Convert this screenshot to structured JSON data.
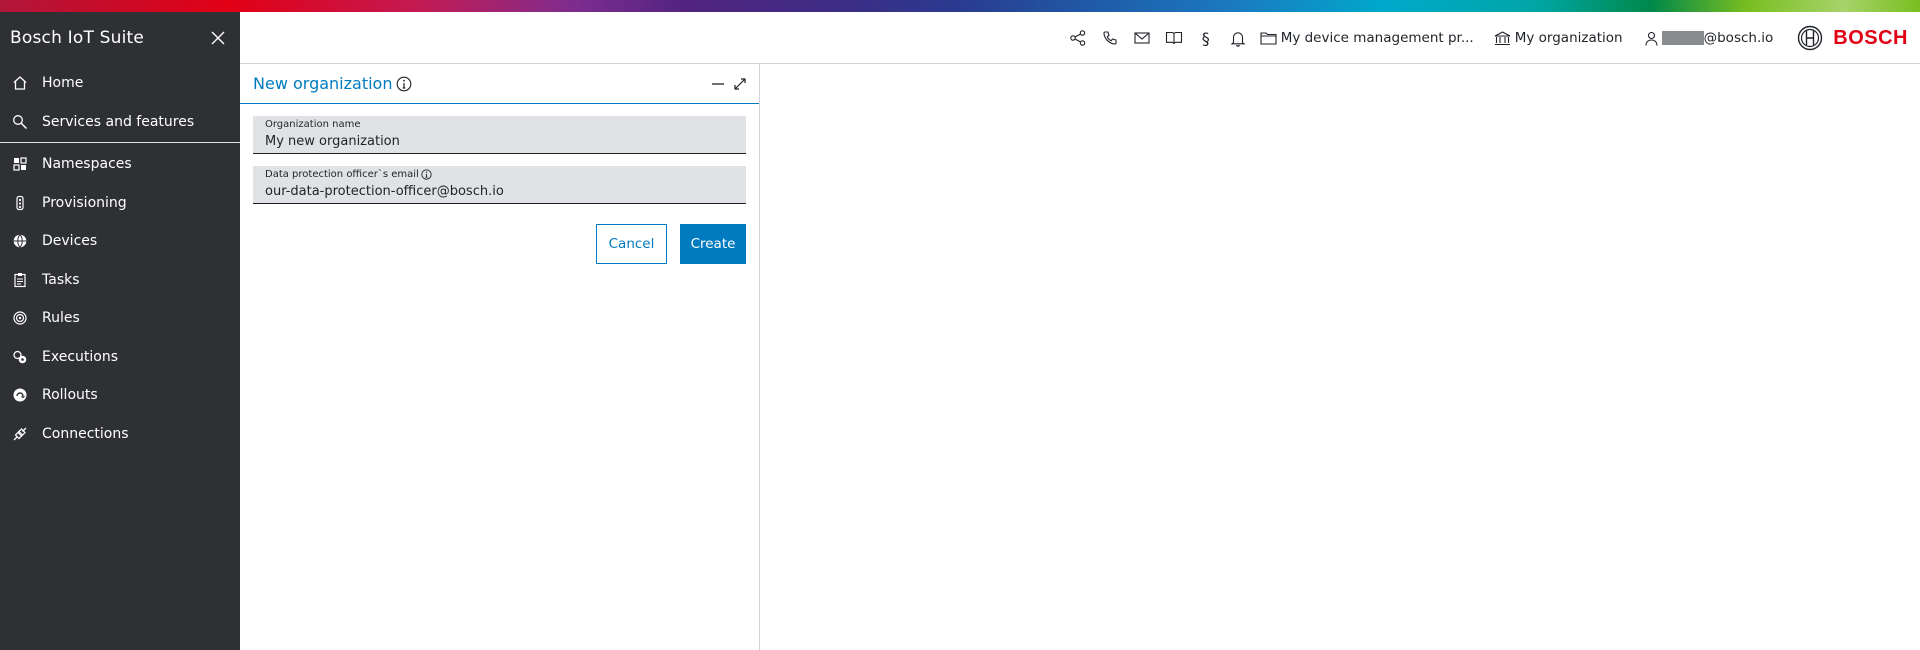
{
  "app": {
    "title": "Bosch IoT Suite"
  },
  "sidebar": {
    "items": [
      {
        "label": "Home",
        "icon": "home-icon"
      },
      {
        "label": "Services and features",
        "icon": "search-icon"
      },
      {
        "label": "Namespaces",
        "icon": "namespaces-icon"
      },
      {
        "label": "Provisioning",
        "icon": "provisioning-icon"
      },
      {
        "label": "Devices",
        "icon": "globe-icon"
      },
      {
        "label": "Tasks",
        "icon": "clipboard-icon"
      },
      {
        "label": "Rules",
        "icon": "rules-icon"
      },
      {
        "label": "Executions",
        "icon": "executions-icon"
      },
      {
        "label": "Rollouts",
        "icon": "rollouts-icon"
      },
      {
        "label": "Connections",
        "icon": "connections-icon"
      }
    ]
  },
  "topbar": {
    "project_label": "My device management pr...",
    "organization_label": "My organization",
    "user_email_suffix": "@bosch.io",
    "paragraph_symbol": "§",
    "brand": "BOSCH"
  },
  "panel": {
    "title": "New organization",
    "fields": {
      "org_name": {
        "label": "Organization name",
        "value": "My new organization"
      },
      "dpo_email": {
        "label": "Data protection officer`s email",
        "value": "our-data-protection-officer@bosch.io"
      }
    },
    "cancel_label": "Cancel",
    "create_label": "Create"
  },
  "colors": {
    "accent": "#007bc0",
    "sidebar_bg": "#2e3033",
    "brand_red": "#e20015",
    "field_bg": "#e0e2e5"
  }
}
